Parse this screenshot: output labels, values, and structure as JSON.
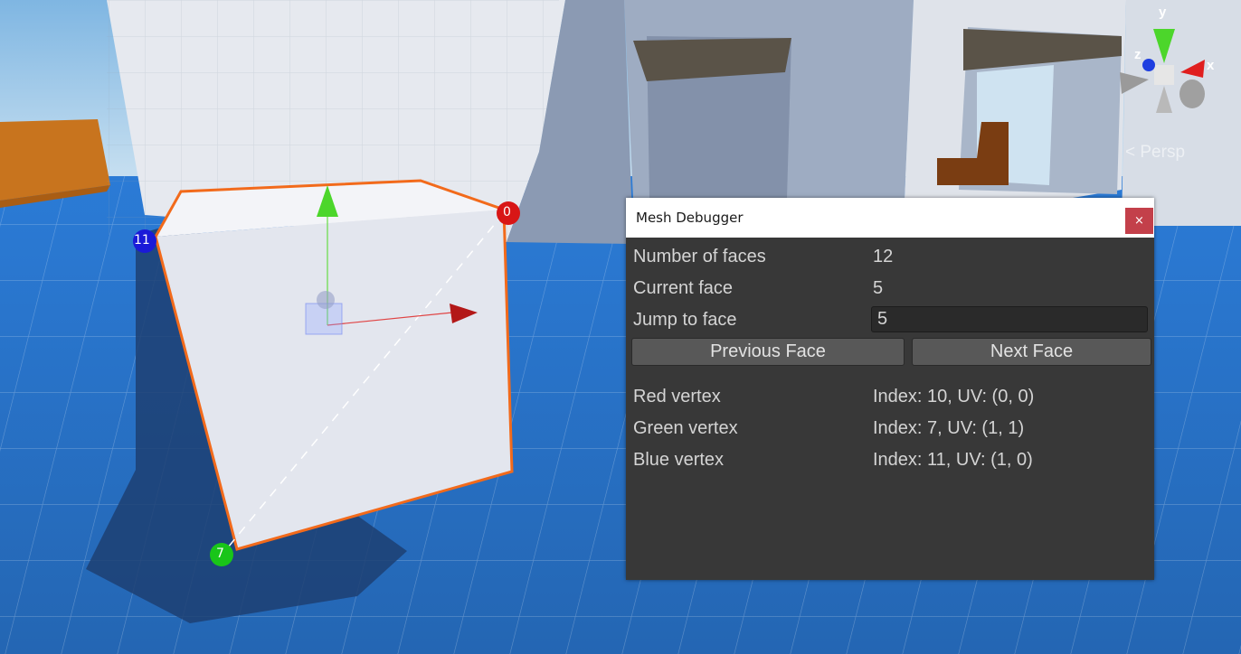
{
  "scene": {
    "vertex_markers": [
      {
        "label": "0",
        "color": "#d81616"
      },
      {
        "label": "11",
        "color": "#1a1ad8"
      },
      {
        "label": "7",
        "color": "#19c519"
      }
    ],
    "gizmo_axes": {
      "x": "x",
      "y": "y",
      "z": "z"
    },
    "projection_label": "Persp"
  },
  "window": {
    "title": "Mesh Debugger",
    "close_label": "×",
    "rows": {
      "faces": {
        "label": "Number of faces",
        "value": "12"
      },
      "current": {
        "label": "Current face",
        "value": "5"
      },
      "jump": {
        "label": "Jump to face",
        "value": "5"
      }
    },
    "buttons": {
      "previous": "Previous Face",
      "next": "Next Face"
    },
    "vertices": {
      "red": {
        "label": "Red vertex",
        "value": "Index: 10, UV: (0, 0)"
      },
      "green": {
        "label": "Green vertex",
        "value": "Index: 7, UV: (1, 1)"
      },
      "blue": {
        "label": "Blue vertex",
        "value": "Index: 11, UV: (1, 0)"
      }
    }
  },
  "colors": {
    "selection_outline": "#f26a1b",
    "window_bg": "#383838",
    "close_button": "#c3404a",
    "floor": "#2f78c8"
  }
}
